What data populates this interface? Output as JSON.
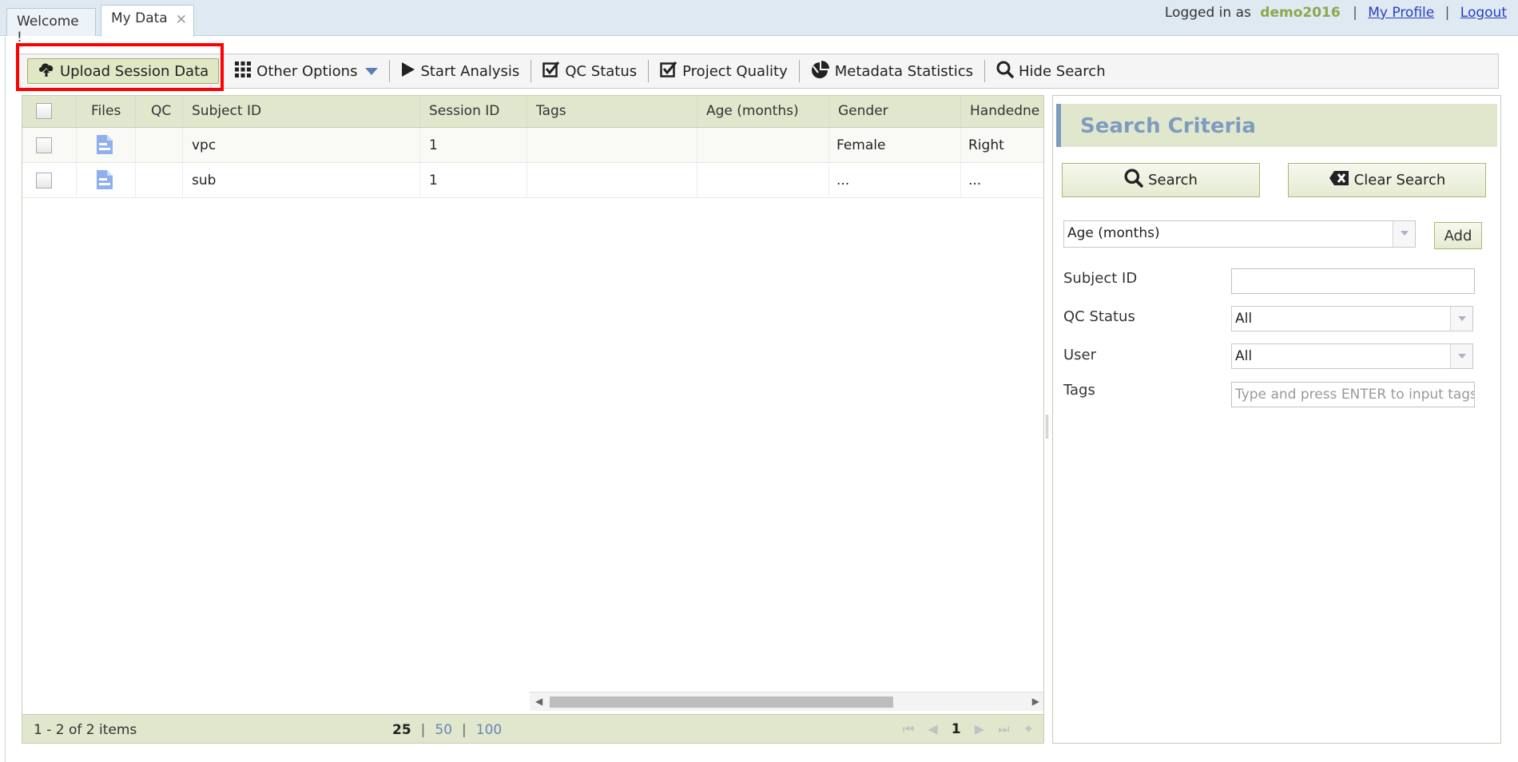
{
  "tabs": {
    "welcome": "Welcome !",
    "mydata": "My Data",
    "close_glyph": "✕"
  },
  "session": {
    "logged_prefix": "Logged in as",
    "username": "demo2016",
    "sep": "|",
    "my_profile": "My Profile",
    "logout": "Logout"
  },
  "toolbar": {
    "upload": "Upload Session Data",
    "other_options": "Other Options",
    "start_analysis": "Start Analysis",
    "qc_status": "QC Status",
    "project_quality": "Project Quality",
    "metadata_statistics": "Metadata Statistics",
    "hide_search": "Hide Search"
  },
  "grid": {
    "columns": [
      "Files",
      "QC",
      "Subject ID",
      "Session ID",
      "Tags",
      "Age (months)",
      "Gender",
      "Handedne"
    ],
    "rows": [
      {
        "subject": "vpc",
        "session": "1",
        "tags": "",
        "age": "",
        "gender": "Female",
        "handedness": "Right"
      },
      {
        "subject": "sub",
        "session": "1",
        "tags": "",
        "age": "",
        "gender": "...",
        "handedness": "..."
      }
    ],
    "footer": {
      "count": "1 - 2 of 2 items",
      "sizes": [
        "25",
        "50",
        "100"
      ],
      "page_sep": "|",
      "page": "1"
    }
  },
  "search": {
    "title": "Search Criteria",
    "search_btn": "Search",
    "clear_btn": "Clear Search",
    "criteria_select": "Age (months)",
    "add_btn": "Add",
    "fields": {
      "subject_label": "Subject ID",
      "subject_value": "",
      "qc_label": "QC Status",
      "qc_value": "All",
      "user_label": "User",
      "user_value": "All",
      "tags_label": "Tags",
      "tags_placeholder": "Type and press ENTER to input tags"
    }
  },
  "colors": {
    "accent_green": "#8aa84a",
    "header_bg": "#e0e7cd",
    "title_blue": "#7e9bc0",
    "highlight": "#ff0000"
  }
}
